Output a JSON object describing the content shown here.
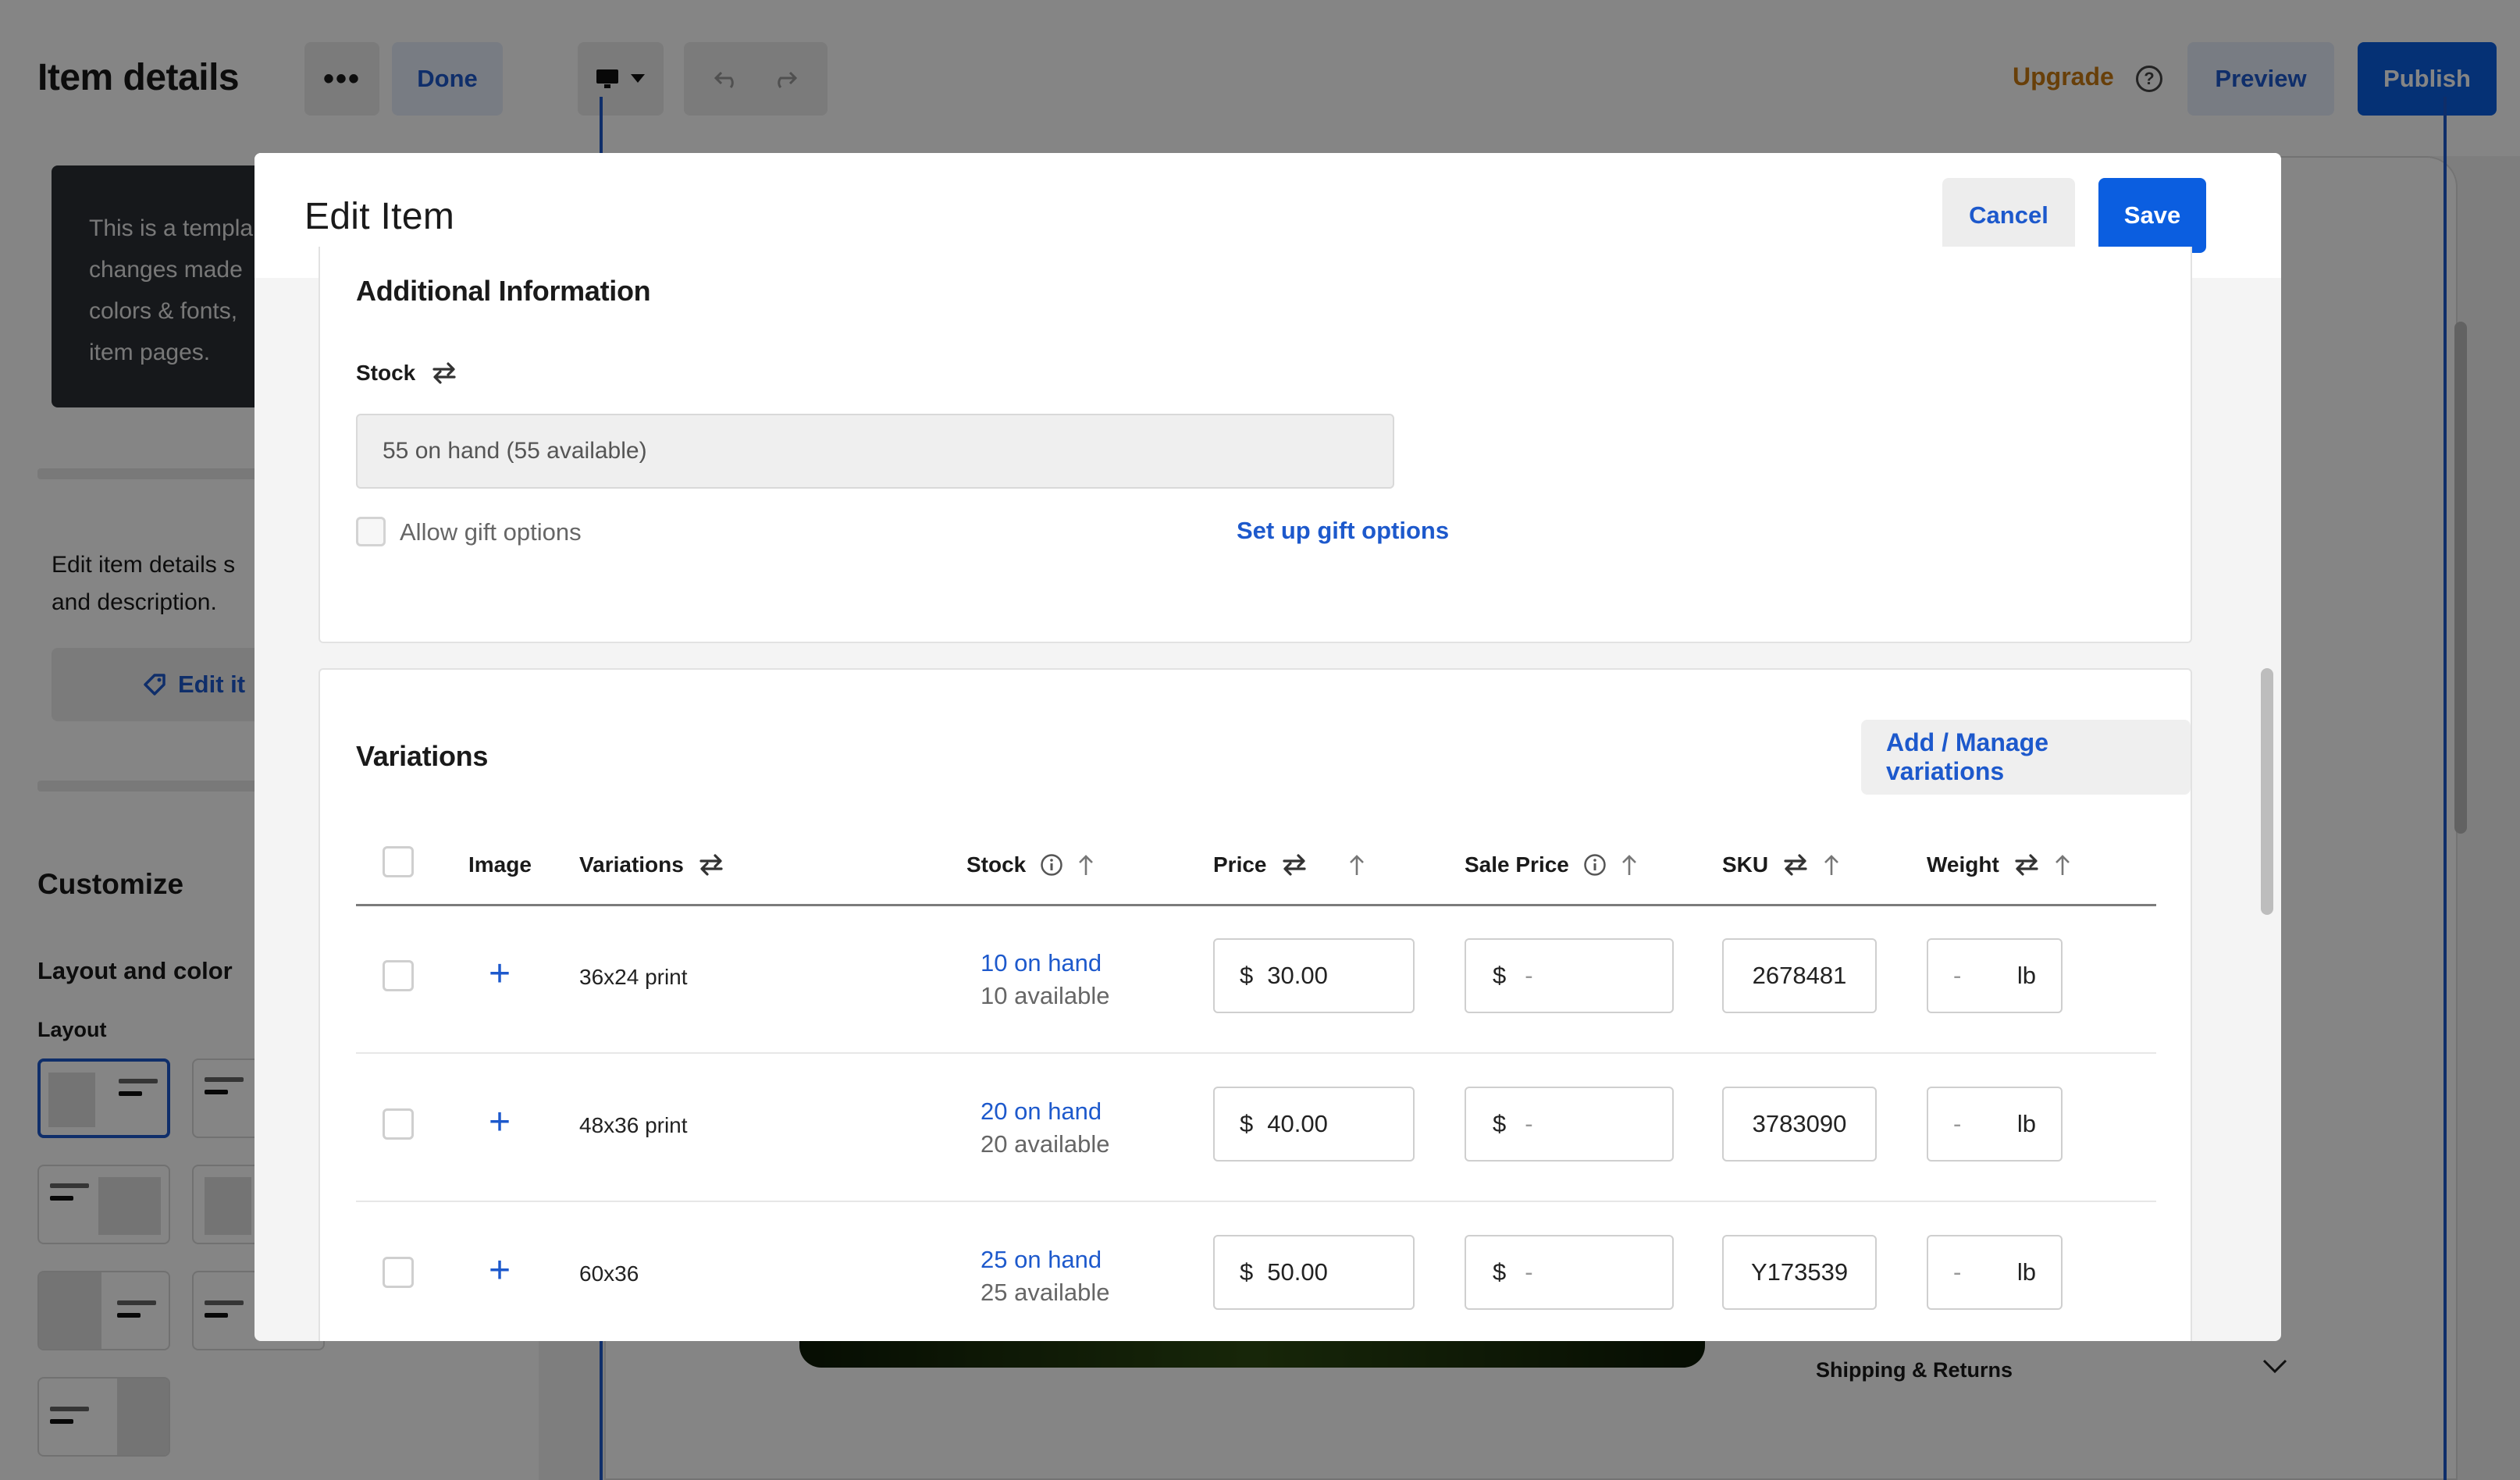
{
  "editor": {
    "title": "Item details",
    "more_label": "•••",
    "done_label": "Done",
    "upgrade_label": "Upgrade",
    "help_label": "?",
    "preview_label": "Preview",
    "publish_label": "Publish",
    "template_note": "This is a templa\nchanges made\ncolors & fonts,\nitem pages.",
    "edit_text": "Edit item details s\nand description.",
    "edit_button_label": "Edit it",
    "customize_heading": "Customize",
    "layout_color_label": "Layout and color",
    "layout_label": "Layout",
    "shipping_label": "Shipping & Returns"
  },
  "modal": {
    "title": "Edit Item",
    "cancel_label": "Cancel",
    "save_label": "Save",
    "additional": {
      "heading": "Additional Information",
      "stock_label": "Stock",
      "stock_value": "55 on hand (55 available)",
      "gift_label": "Allow gift options",
      "gift_link": "Set up gift options"
    },
    "variations": {
      "heading": "Variations",
      "manage_label": "Add / Manage variations",
      "columns": {
        "image": "Image",
        "variations": "Variations",
        "stock": "Stock",
        "price": "Price",
        "sale_price": "Sale Price",
        "sku": "SKU",
        "weight": "Weight"
      },
      "rows": [
        {
          "name": "36x24 print",
          "on_hand": "10 on hand",
          "available": "10 available",
          "currency": "$",
          "price": "30.00",
          "sale": "-",
          "sku": "2678481",
          "weight": "-",
          "unit": "lb"
        },
        {
          "name": "48x36 print",
          "on_hand": "20 on hand",
          "available": "20 available",
          "currency": "$",
          "price": "40.00",
          "sale": "-",
          "sku": "3783090",
          "weight": "-",
          "unit": "lb"
        },
        {
          "name": "60x36",
          "on_hand": "25 on hand",
          "available": "25 available",
          "currency": "$",
          "price": "50.00",
          "sale": "-",
          "sku": "Y173539",
          "weight": "-",
          "unit": "lb"
        }
      ]
    }
  },
  "colors": {
    "accent": "#0b5ee0",
    "link": "#1d59cc",
    "upgrade": "#c77a12"
  },
  "icons": [
    "more-icon",
    "monitor-icon",
    "undo-icon",
    "redo-icon",
    "help-icon",
    "tag-icon",
    "swap-icon",
    "info-icon",
    "sort-up-icon",
    "plus-icon",
    "chevron-down-icon"
  ]
}
